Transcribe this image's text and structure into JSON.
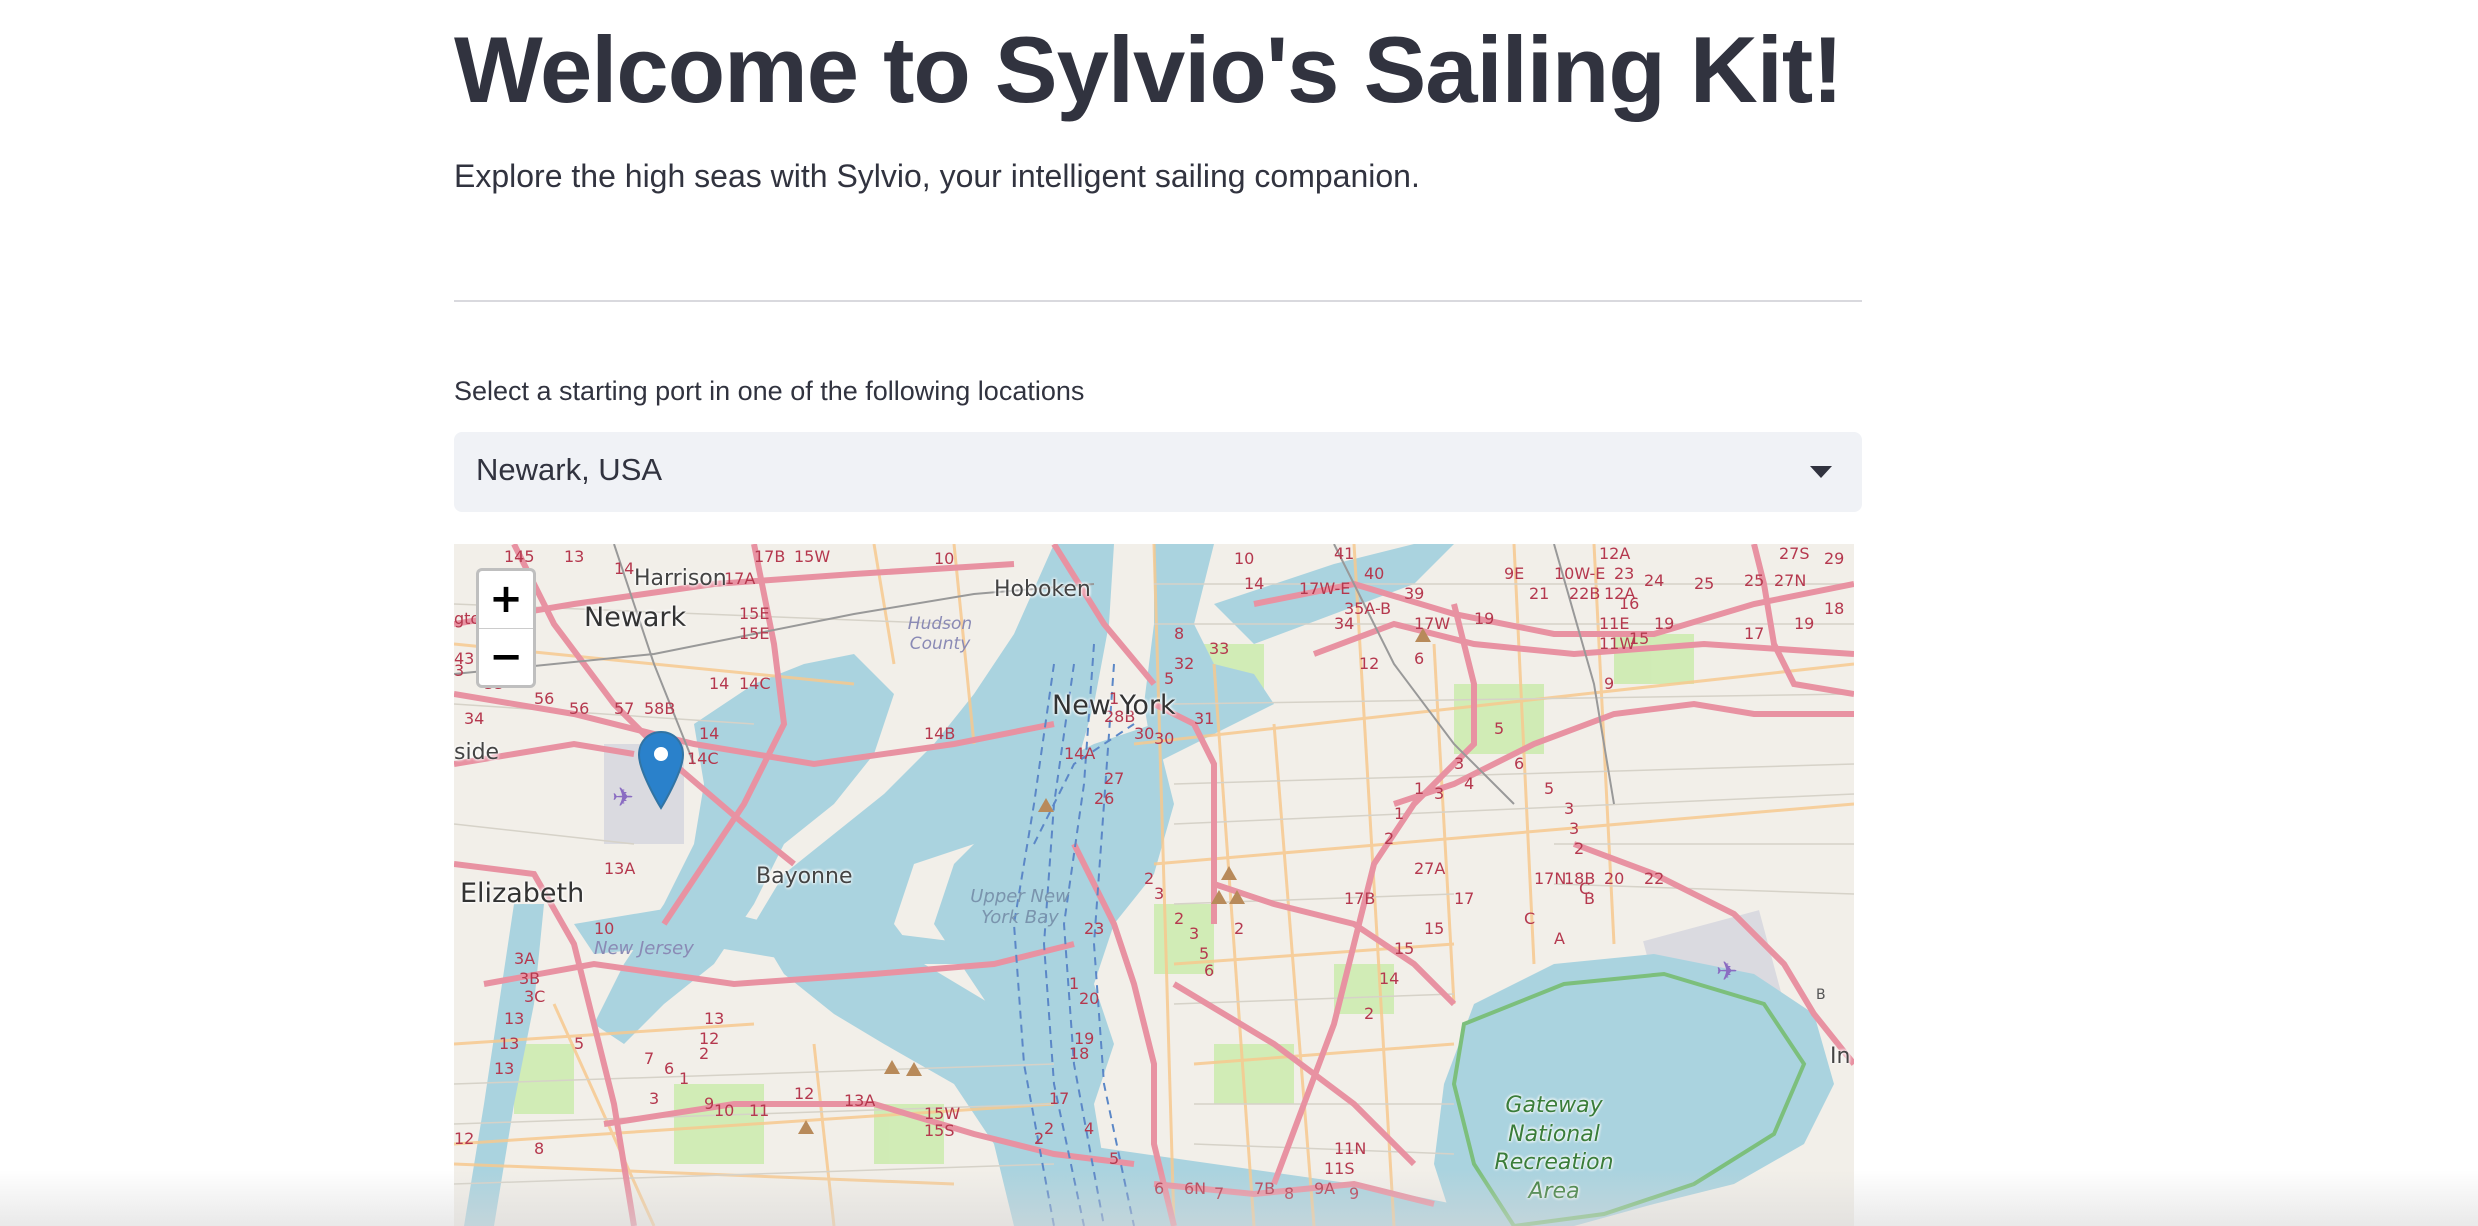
{
  "header": {
    "title": "Welcome to Sylvio's Sailing Kit!",
    "subtitle": "Explore the high seas with Sylvio, your intelligent sailing companion."
  },
  "port_select": {
    "label": "Select a starting port in one of the following locations",
    "selected_value": "Newark, USA",
    "caret_icon": "caret-down-icon"
  },
  "map": {
    "zoom_in_label": "+",
    "zoom_out_label": "−",
    "marker_icon": "map-marker-icon",
    "places": {
      "newark": "Newark",
      "harrison": "Harrison",
      "hoboken": "Hoboken",
      "new_york": "New York",
      "hudson_county": "Hudson County",
      "elizabeth": "Elizabeth",
      "bayonne": "Bayonne",
      "new_jersey": "New Jersey",
      "upper_bay": "Upper New York Bay",
      "gateway_1": "Gateway",
      "gateway_2": "National",
      "gateway_3": "Recreation",
      "gateway_4": "Area",
      "side": "side",
      "in": "In"
    },
    "colors": {
      "land": "#f2efe9",
      "water": "#aad3df",
      "motorway": "#e892a2",
      "primary_road": "#fcd6a4",
      "park": "#c8facc",
      "marker": "#2a81cb"
    }
  }
}
